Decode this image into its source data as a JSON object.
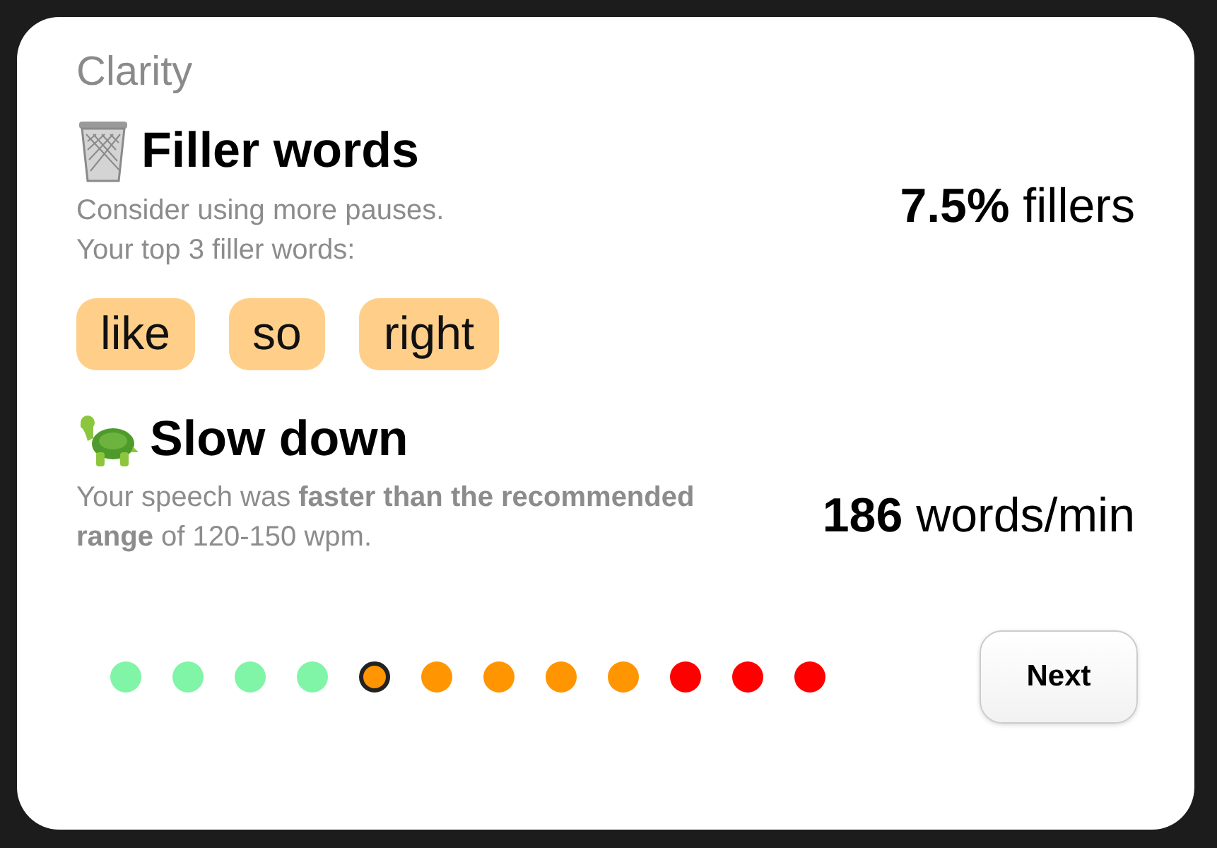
{
  "card": {
    "heading": "Clarity",
    "sections": [
      {
        "kind": "fillers",
        "title": "Filler words",
        "text": "Consider using more pauses.\nYour top 3 filler words:",
        "stat_value": "7.5%",
        "stat_unit": "fillers",
        "tags": [
          "like",
          "so",
          "right"
        ]
      },
      {
        "kind": "pace",
        "title": "Slow down",
        "text": "Your speech was **faster than the recommended range** of 120-150 wpm.",
        "stat_value": "186",
        "stat_unit": "words/min"
      }
    ],
    "dots": [
      {
        "color": "#80f5a8",
        "selected": false
      },
      {
        "color": "#80f5a8",
        "selected": false
      },
      {
        "color": "#80f5a8",
        "selected": false
      },
      {
        "color": "#80f5a8",
        "selected": false
      },
      {
        "color": "#ff9500",
        "selected": true
      },
      {
        "color": "#ff9500",
        "selected": false
      },
      {
        "color": "#ff9500",
        "selected": false
      },
      {
        "color": "#ff9500",
        "selected": false
      },
      {
        "color": "#ff9500",
        "selected": false
      },
      {
        "color": "#ff0000",
        "selected": false
      },
      {
        "color": "#ff0000",
        "selected": false
      },
      {
        "color": "#ff0000",
        "selected": false
      }
    ],
    "button": "Next"
  }
}
